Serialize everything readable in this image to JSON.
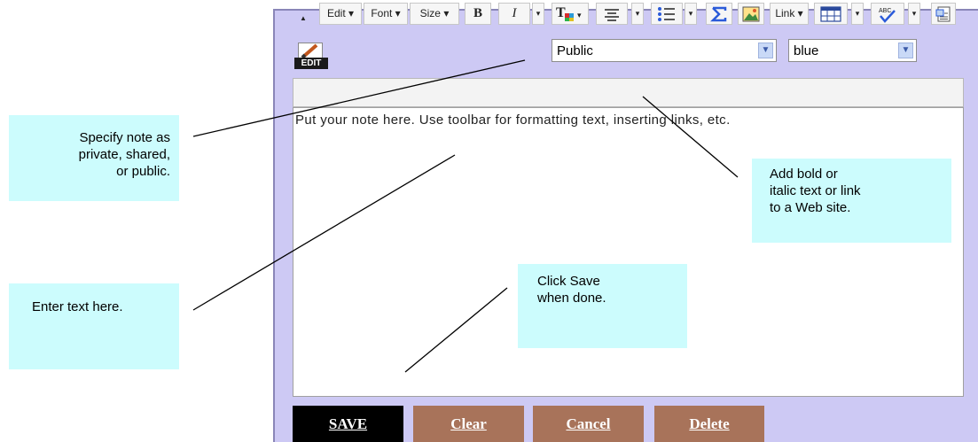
{
  "panel": {
    "edit_icon_label": "EDIT",
    "visibility_select": {
      "value": "Public"
    },
    "color_select": {
      "value": "blue"
    }
  },
  "toolbar": {
    "edit_menu": "Edit",
    "font_menu": "Font",
    "size_menu": "Size",
    "bold": "B",
    "italic": "I",
    "link_menu": "Link"
  },
  "editor": {
    "text": "Put your note here. Use toolbar for formatting text, inserting links, etc."
  },
  "buttons": {
    "save": "SAVE",
    "clear": "Clear",
    "cancel": "Cancel",
    "delete": "Delete"
  },
  "callouts": {
    "privacy": [
      "Specify note as",
      "private, shared,",
      "or public."
    ],
    "enter_text": "Enter text here.",
    "formatting": [
      "Add bold or",
      "italic text or link",
      "to a Web site."
    ],
    "save": [
      "Click Save",
      "when done."
    ]
  },
  "colors": {
    "panel": "#cdc9f4",
    "callout": "#ccfcfd",
    "save_button": "#000000",
    "brown_button": "#a8735a"
  }
}
